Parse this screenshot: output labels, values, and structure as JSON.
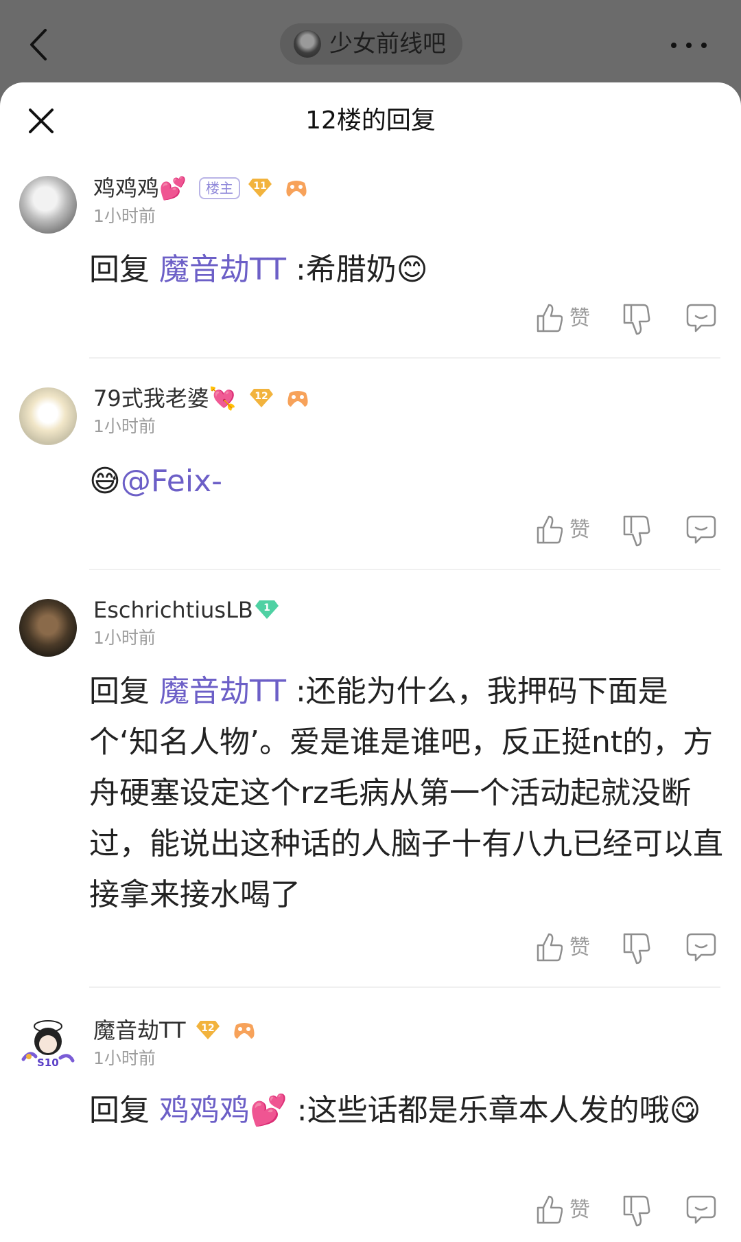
{
  "topbar": {
    "forum_name": "少女前线吧"
  },
  "sheet": {
    "title": "12楼的回复"
  },
  "comments": [
    {
      "username": "鸡鸡鸡💕",
      "host_badge": "楼主",
      "level": "11",
      "time": "1小时前",
      "reply_prefix": "回复",
      "reply_to": "魔音劫TT",
      "text": " :希腊奶😊",
      "like_label": "赞"
    },
    {
      "username": "79式我老婆💘",
      "level": "12",
      "time": "1小时前",
      "text_emoji": "😅",
      "mention": "@Feix-",
      "like_label": "赞"
    },
    {
      "username": "EschrichtiusLB",
      "level": "1",
      "time": "1小时前",
      "reply_prefix": "回复",
      "reply_to": "魔音劫TT",
      "text": " :还能为什么，我押码下面是个‘知名人物’。爱是谁是谁吧，反正挺nt的，方舟硬塞设定这个rz毛病从第一个活动起就没断过，能说出这种话的人脑子十有八九已经可以直接拿来接水喝了",
      "like_label": "赞"
    },
    {
      "username": "魔音劫TT",
      "level": "12",
      "time": "1小时前",
      "reply_prefix": "回复",
      "reply_to": "鸡鸡鸡💕",
      "text": " :这些话都是乐章本人发的哦😋",
      "like_label": "赞",
      "avatar_tag": "S10"
    }
  ],
  "colors": {
    "mention": "#6c5fc7",
    "level_badge": "#f2b33d",
    "vip_badge": "#4fd1a3"
  }
}
